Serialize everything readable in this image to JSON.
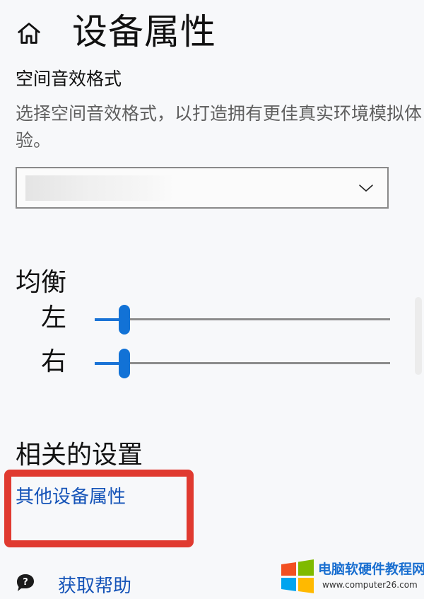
{
  "header": {
    "icon": "home-icon",
    "title": "设备属性"
  },
  "spatial_sound": {
    "label": "空间音效格式",
    "description": "选择空间音效格式，以打造拥有更佳真实环境模拟体验。",
    "dropdown": {
      "value": "",
      "icon": "chevron-down-icon"
    }
  },
  "balance": {
    "title": "均衡",
    "left_label": "左",
    "left_value": 0.1,
    "right_label": "右",
    "right_value": 0.1,
    "accent_color": "#1272d6"
  },
  "related": {
    "title": "相关的设置",
    "link_other": "其他设备属性",
    "help_icon": "help-chat-icon",
    "link_help": "获取帮助",
    "highlight_color": "#e03a30"
  },
  "watermark": {
    "text": "电脑软硬件教程网",
    "url": "www.computer26.com"
  }
}
